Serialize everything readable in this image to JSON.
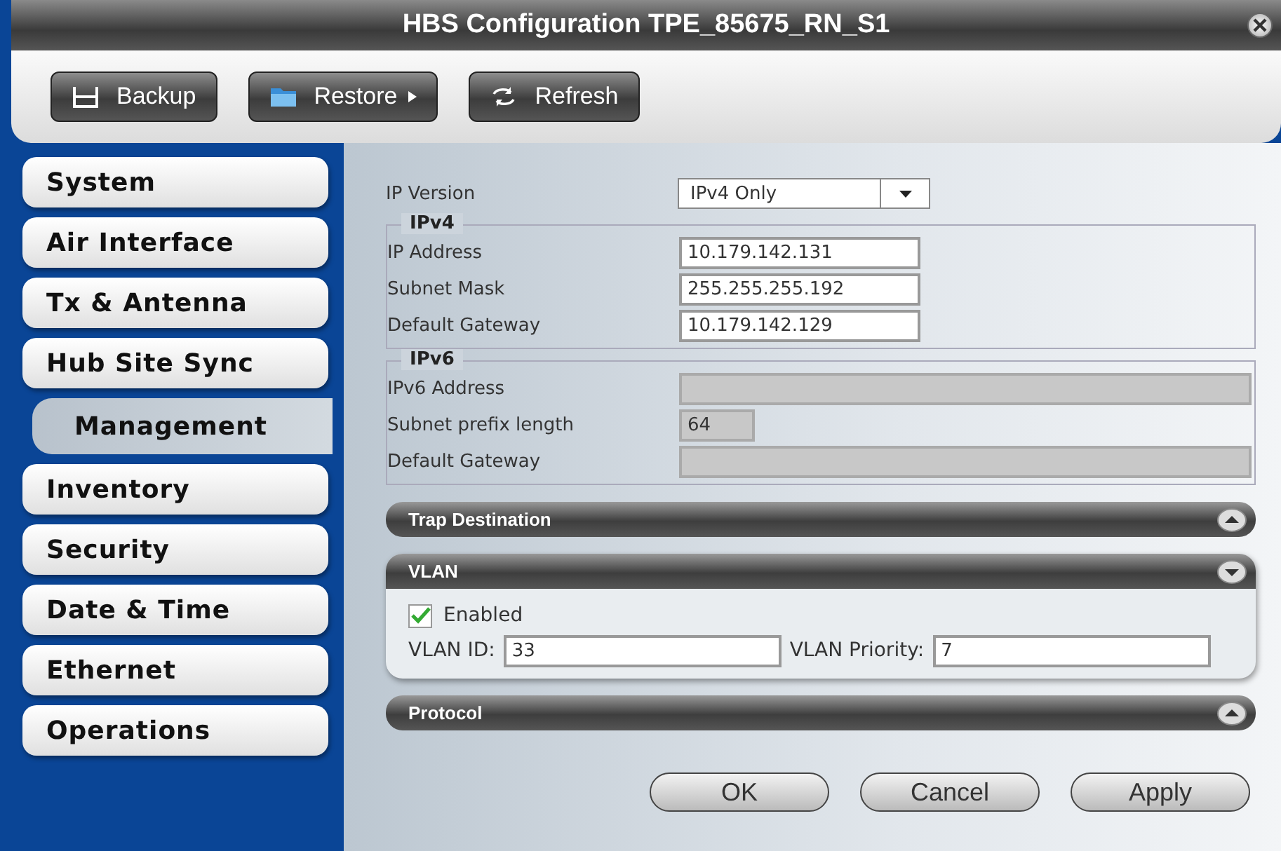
{
  "window": {
    "title": "HBS Configuration TPE_85675_RN_S1"
  },
  "toolbar": [
    {
      "label": "Backup",
      "menu": false
    },
    {
      "label": "Restore",
      "menu": true
    },
    {
      "label": "Refresh",
      "menu": false
    }
  ],
  "sidebar": {
    "items": [
      {
        "label": "System",
        "selected": false
      },
      {
        "label": "Air Interface",
        "selected": false
      },
      {
        "label": "Tx & Antenna",
        "selected": false
      },
      {
        "label": "Hub Site Sync",
        "selected": false
      },
      {
        "label": "Management",
        "selected": true
      },
      {
        "label": "Inventory",
        "selected": false
      },
      {
        "label": "Security",
        "selected": false
      },
      {
        "label": "Date & Time",
        "selected": false
      },
      {
        "label": "Ethernet",
        "selected": false
      },
      {
        "label": "Operations",
        "selected": false
      }
    ]
  },
  "ip_version": {
    "label": "IP Version",
    "value": "IPv4 Only"
  },
  "groups": [
    {
      "title": "IPv4",
      "fields": [
        {
          "label": "IP Address",
          "value": "10.179.142.131",
          "disabled": false,
          "kind": "medium"
        },
        {
          "label": "Subnet Mask",
          "value": "255.255.255.192",
          "disabled": false,
          "kind": "medium"
        },
        {
          "label": "Default Gateway",
          "value": "10.179.142.129",
          "disabled": false,
          "kind": "medium"
        }
      ]
    },
    {
      "title": "IPv6",
      "fields": [
        {
          "label": "IPv6 Address",
          "disabled": true,
          "kind": "wide"
        },
        {
          "label": "Subnet prefix length",
          "value": "64",
          "disabled": true,
          "kind": "small"
        },
        {
          "label": "Default Gateway",
          "disabled": true,
          "kind": "wide"
        }
      ]
    }
  ],
  "sections": [
    {
      "title": "Trap Destination",
      "expanded": false
    },
    {
      "title": "VLAN",
      "expanded": true,
      "enabled": {
        "label": "Enabled",
        "checked": true
      },
      "vlan_id": {
        "label": "VLAN ID:",
        "value": "33"
      },
      "priority": {
        "label": "VLAN Priority:",
        "value": "7"
      }
    },
    {
      "title": "Protocol",
      "expanded": false
    }
  ],
  "buttons": [
    "OK",
    "Cancel",
    "Apply"
  ]
}
